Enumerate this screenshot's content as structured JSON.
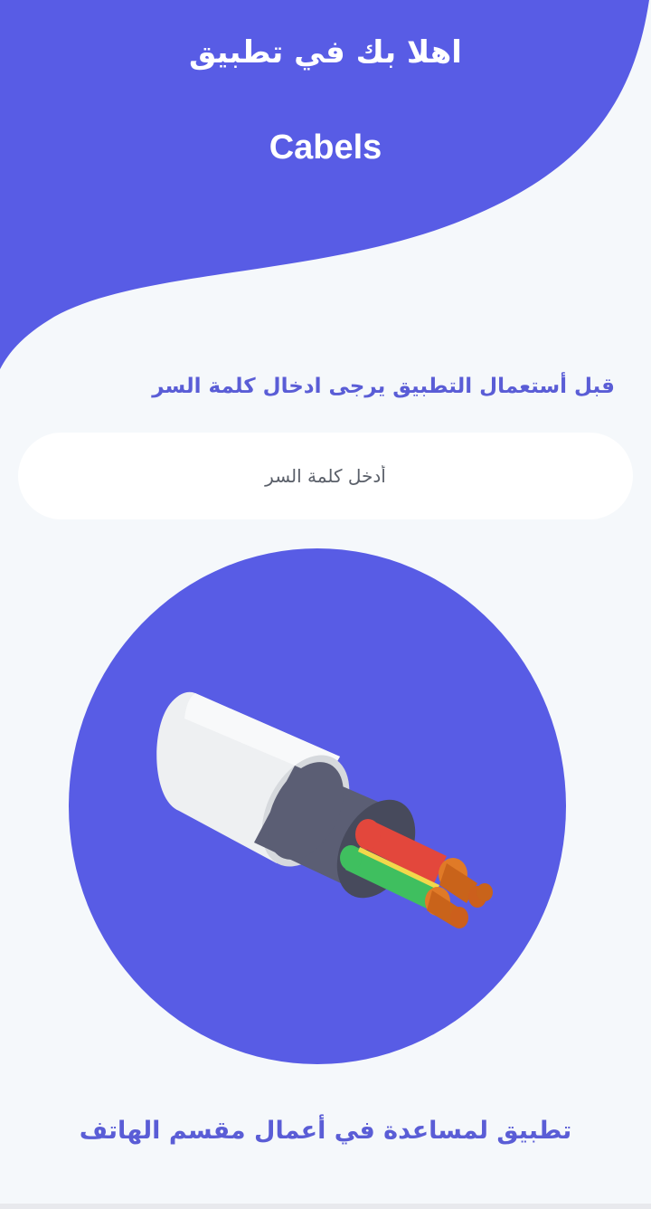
{
  "header": {
    "welcome_title": "اهلا بك في تطبيق",
    "app_name": "Cabels"
  },
  "login": {
    "instruction": "قبل أستعمال التطبيق يرجى ادخال كلمة السر",
    "password_placeholder": "أدخل كلمة السر",
    "password_value": ""
  },
  "illustration": {
    "icon": "cable-icon"
  },
  "footer": {
    "description": "تطبيق لمساعدة في أعمال مقسم الهاتف"
  },
  "colors": {
    "primary": "#585ce5",
    "background": "#f5f8fb",
    "text_accent": "#5a5dd6",
    "field_bg": "#ffffff"
  }
}
